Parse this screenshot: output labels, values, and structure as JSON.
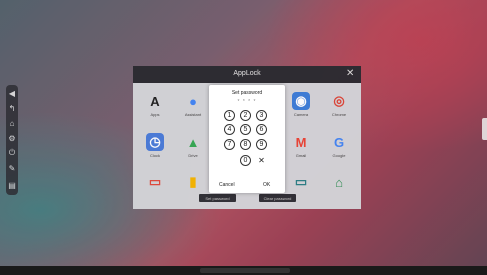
{
  "applock": {
    "title": "AppLock",
    "close_icon": "✕",
    "apps": [
      {
        "id": "apps",
        "label": "Apps",
        "glyph": "A",
        "color": "#222222",
        "bg": "transparent"
      },
      {
        "id": "assistant",
        "label": "Assistant",
        "glyph": "●",
        "color": "#4285f4",
        "bg": "transparent"
      },
      {
        "id": "camera",
        "label": "Camera",
        "glyph": "◉",
        "color": "#ffffff",
        "bg": "#3b7dd8"
      },
      {
        "id": "chrome",
        "label": "Chrome",
        "glyph": "◎",
        "color": "#db4437",
        "bg": "transparent"
      },
      {
        "id": "clock",
        "label": "Clock",
        "glyph": "◷",
        "color": "#ffffff",
        "bg": "#4a7bd9"
      },
      {
        "id": "drive",
        "label": "Drive",
        "glyph": "▲",
        "color": "#34a853",
        "bg": "transparent"
      },
      {
        "id": "gmail",
        "label": "Gmail",
        "glyph": "M",
        "color": "#ea4335",
        "bg": "transparent"
      },
      {
        "id": "google",
        "label": "Google",
        "glyph": "G",
        "color": "#4285f4",
        "bg": "transparent"
      },
      {
        "id": "row3-1",
        "label": "",
        "glyph": "▭",
        "color": "#e04a3c",
        "bg": "transparent"
      },
      {
        "id": "row3-2",
        "label": "",
        "glyph": "▮",
        "color": "#f4b400",
        "bg": "transparent"
      },
      {
        "id": "row3-3",
        "label": "",
        "glyph": "▭",
        "color": "#2a7f86",
        "bg": "transparent"
      },
      {
        "id": "row3-4",
        "label": "",
        "glyph": "⌂",
        "color": "#2f8f54",
        "bg": "transparent"
      }
    ],
    "set_password_label": "Set password",
    "clear_password_label": "Clear password"
  },
  "password_dialog": {
    "title": "Set password",
    "dots": "* * * *",
    "keys": [
      "1",
      "2",
      "3",
      "4",
      "5",
      "6",
      "7",
      "8",
      "9",
      "0"
    ],
    "delete_glyph": "✕",
    "cancel_label": "Cancel",
    "ok_label": "OK"
  },
  "side_rail": {
    "icons": [
      {
        "name": "collapse-icon",
        "glyph": "◀"
      },
      {
        "name": "back-icon",
        "glyph": "↰"
      },
      {
        "name": "home-icon",
        "glyph": "⌂"
      },
      {
        "name": "settings-icon",
        "glyph": "⚙"
      },
      {
        "name": "input-source-icon",
        "glyph": "⏻"
      },
      {
        "name": "annotate-icon",
        "glyph": "✎"
      },
      {
        "name": "window-icon",
        "glyph": "▤"
      }
    ]
  }
}
